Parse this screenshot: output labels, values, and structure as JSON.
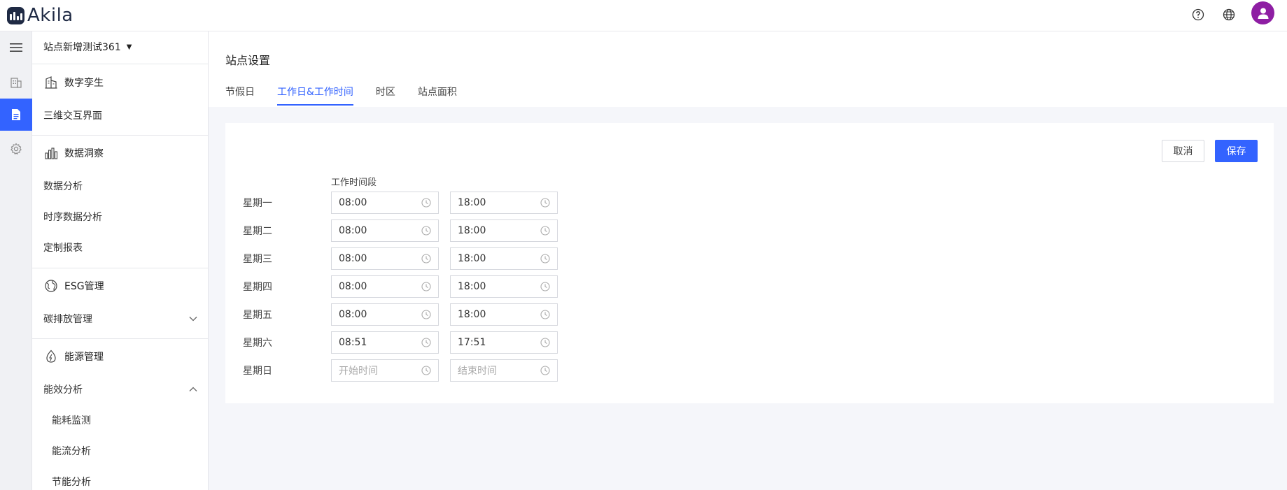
{
  "app": {
    "logo_text": "Akila"
  },
  "header": {
    "icons": [
      "help-icon",
      "globe-icon",
      "user-icon"
    ]
  },
  "rail": {
    "icons": [
      "hamburger-menu-icon",
      "building-icon",
      "document-icon",
      "gear-icon"
    ],
    "active_index": 2
  },
  "menu": {
    "site_name": "站点新增测试361",
    "groups": [
      {
        "title": "数字孪生",
        "icon": "building-outline-icon",
        "items": [
          {
            "label": "三维交互界面"
          }
        ]
      },
      {
        "title": "数据洞察",
        "icon": "bar-chart-icon",
        "items": [
          {
            "label": "数据分析"
          },
          {
            "label": "时序数据分析"
          },
          {
            "label": "定制报表"
          }
        ]
      },
      {
        "title": "ESG管理",
        "icon": "globe-leaf-icon",
        "items": [
          {
            "label": "碳排放管理",
            "expand": "collapsed"
          }
        ]
      },
      {
        "title": "能源管理",
        "icon": "energy-drop-icon",
        "items": [
          {
            "label": "能效分析",
            "expand": "expanded"
          }
        ],
        "sub_items": [
          {
            "label": "能耗监测"
          },
          {
            "label": "能流分析"
          },
          {
            "label": "节能分析"
          }
        ]
      }
    ]
  },
  "page": {
    "title": "站点设置",
    "tabs": [
      {
        "label": "节假日"
      },
      {
        "label": "工作日&工作时间",
        "active": true
      },
      {
        "label": "时区"
      },
      {
        "label": "站点面积"
      }
    ],
    "cancel_label": "取消",
    "save_label": "保存",
    "column_header": "工作时间段",
    "schedule": [
      {
        "day": "星期一",
        "start": "08:00",
        "end": "18:00"
      },
      {
        "day": "星期二",
        "start": "08:00",
        "end": "18:00"
      },
      {
        "day": "星期三",
        "start": "08:00",
        "end": "18:00"
      },
      {
        "day": "星期四",
        "start": "08:00",
        "end": "18:00"
      },
      {
        "day": "星期五",
        "start": "08:00",
        "end": "18:00"
      },
      {
        "day": "星期六",
        "start": "08:51",
        "end": "17:51"
      },
      {
        "day": "星期日",
        "start": "",
        "end": "",
        "start_placeholder": "开始时间",
        "end_placeholder": "结束时间"
      }
    ]
  },
  "colors": {
    "accent": "#3363ff",
    "avatar": "#8e1ea3",
    "logo": "#1f2a44"
  }
}
